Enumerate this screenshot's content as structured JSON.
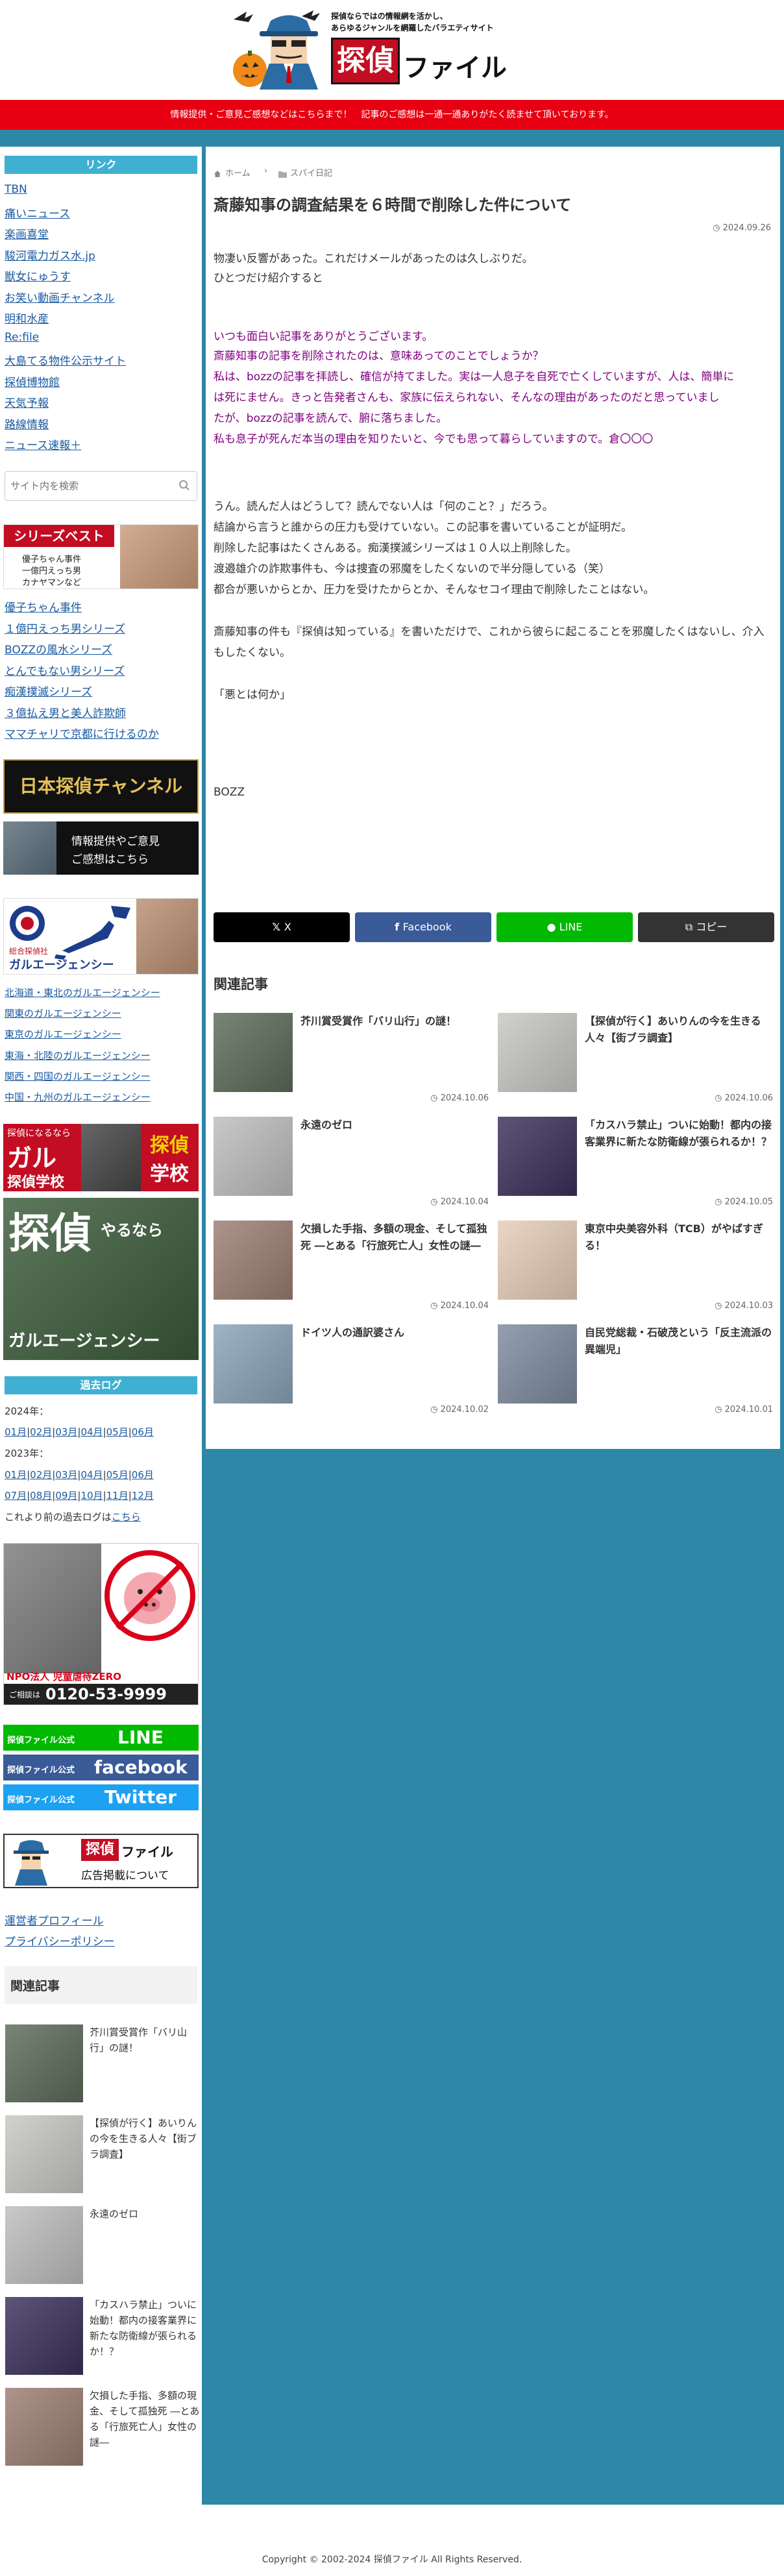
{
  "header": {
    "tagline_1": "探偵ならではの情報網を活かし、",
    "tagline_2": "あらゆるジャンルを網羅したバラエティサイト",
    "logo_text_1": "探偵",
    "logo_text_2": "ファイル"
  },
  "notice": "情報提供・ご意見ご感想などはこちらまで！　記事のご感想は一通一通ありがたく読ませて頂いております。",
  "sidebar": {
    "links_heading": "リンク",
    "links": [
      "TBN",
      "痛いニュース",
      "楽画喜堂",
      "駿河電力ガス水.jp",
      "獣女にゅうす",
      "お笑い動画チャンネル",
      "明和水産",
      "Re:file",
      "大島てる物件公示サイト",
      "探偵博物館",
      "天気予報",
      "路線情報",
      "ニュース速報＋"
    ],
    "search_placeholder": "サイト内を検索",
    "series_banner": {
      "title": "シリーズベスト",
      "line1": "優子ちゃん事件",
      "line2": "一億円えっち男",
      "line3": "カナヤマンなど"
    },
    "series": [
      "優子ちゃん事件",
      "１億円えっち男シリーズ",
      "BOZZの風水シリーズ",
      "とんでもない男シリーズ",
      "痴漢撲滅シリーズ",
      "３億払え男と美人詐欺師",
      "ママチャリで京都に行けるのか"
    ],
    "nihon_banner": "日本探偵チャンネル",
    "info_banner": {
      "line1": "情報提供やご意見",
      "line2": "ご感想はこちら"
    },
    "agency_banner": {
      "label": "総合探偵社",
      "name": "ガルエージェンシー"
    },
    "regions": [
      "北海道・東北のガルエージェンシー",
      "関東のガルエージェンシー",
      "東京のガルエージェンシー",
      "東海・北陸のガルエージェンシー",
      "関西・四国のガルエージェンシー",
      "中国・九州のガルエージェンシー"
    ],
    "school_banner": {
      "line1": "探偵になるなら",
      "line2": "ガル",
      "line3": "探偵学校",
      "side1": "探偵",
      "side2": "学校"
    },
    "tantei_banner": {
      "line1": "探偵",
      "line2": "やるなら",
      "line3": "ガルエージェンシー"
    },
    "archive_heading": "過去ログ",
    "archive_2024_label": "2024年：",
    "archive_2024": [
      "01月",
      "02月",
      "03月",
      "04月",
      "05月",
      "06月"
    ],
    "archive_2023_label": "2023年：",
    "archive_2023_a": [
      "01月",
      "02月",
      "03月",
      "04月",
      "05月",
      "06月"
    ],
    "archive_2023_b": [
      "07月",
      "08月",
      "09月",
      "10月",
      "11月",
      "12月"
    ],
    "archive_more_text": "これより前の過去ログは",
    "archive_more_link": "こちら",
    "npo_banner": {
      "name": "NPO法人 児童虐待ZERO",
      "contact": "ご相談は",
      "phone": "0120-53-9999"
    },
    "sns_prefix": "探偵ファイル公式",
    "sns": [
      "LINE",
      "facebook",
      "Twitter"
    ],
    "ad_banner": {
      "logo1": "探偵",
      "logo2": "ファイル",
      "text": "広告掲載について"
    },
    "bottom_links": [
      "運営者プロフィール",
      "プライバシーポリシー"
    ],
    "related_heading": "関連記事",
    "related": [
      "芥川賞受賞作「バリ山行」の謎！",
      "【探偵が行く】あいりんの今を生きる人々【街ブラ調査】",
      "永遠のゼロ",
      "「カスハラ禁止」ついに始動！都内の接客業界に新たな防衛線が張られるか！？",
      "欠損した手指、多額の現金、そして孤独死 ―とある「行旅死亡人」女性の謎―"
    ]
  },
  "main": {
    "breadcrumb": [
      "ホーム",
      "スパイ日記"
    ],
    "title": "斎藤知事の調査結果を６時間で削除した件について",
    "date": "2024.09.26",
    "intro": [
      "物凄い反響があった。これだけメールがあったのは久しぶりだ。",
      "ひとつだけ紹介すると"
    ],
    "quote": [
      "いつも面白い記事をありがとうございます。",
      "斎藤知事の記事を削除されたのは、意味あってのことでしょうか？",
      "私は、bozzの記事を拝読し、確信が持てました。実は一人息子を自死で亡くしていますが、人は、簡単に",
      "は死にません。きっと告発者さんも、家族に伝えられない、そんなの理由があったのだと思っていまし",
      "たが、bozzの記事を読んで、腑に落ちました。",
      "私も息子が死んだ本当の理由を知りたいと、今でも思って暮らしていますので。倉〇〇〇"
    ],
    "body1": [
      "うん。読んだ人はどうして？読んでない人は「何のこと？」だろう。",
      "結論から言うと誰からの圧力も受けていない。この記事を書いていることが証明だ。",
      "削除した記事はたくさんある。痴漢撲滅シリーズは１０人以上削除した。",
      "渡邉雄介の詐欺事件も、今は捜査の邪魔をしたくないので半分隠している（笑）",
      "都合が悪いからとか、圧力を受けたからとか、そんなセコイ理由で削除したことはない。"
    ],
    "body2": [
      "斎藤知事の件も『探偵は知っている』を書いただけで、これから彼らに起こることを邪魔したくはないし、介入もしたくない。"
    ],
    "body3": "「悪とは何か」",
    "signature": "BOZZ",
    "share": {
      "x": "X",
      "facebook": "Facebook",
      "line": "LINE",
      "copy": "コピー"
    },
    "share_colors": {
      "x": "#000000",
      "facebook": "#3a5a98",
      "line": "#00b900",
      "copy": "#333333"
    },
    "related_heading": "関連記事",
    "related": [
      {
        "title": "芥川賞受賞作「バリ山行」の謎！",
        "date": "2024.10.06"
      },
      {
        "title": "【探偵が行く】あいりんの今を生きる人々【街ブラ調査】",
        "date": "2024.10.06"
      },
      {
        "title": "永遠のゼロ",
        "date": "2024.10.04"
      },
      {
        "title": "「カスハラ禁止」ついに始動！都内の接客業界に新たな防衛線が張られるか！？",
        "date": "2024.10.05"
      },
      {
        "title": "欠損した手指、多額の現金、そして孤独死 ―とある「行旅死亡人」女性の謎―",
        "date": "2024.10.04"
      },
      {
        "title": "東京中央美容外科（TCB）がやばすぎる！",
        "date": "2024.10.03"
      },
      {
        "title": "ドイツ人の通訳婆さん",
        "date": "2024.10.02"
      },
      {
        "title": "自民党総裁・石破茂という「反主流派の異端児」",
        "date": "2024.10.01"
      }
    ]
  },
  "footer": {
    "copyright": "Copyright © 2002-2024 探偵ファイル All Rights Reserved."
  },
  "colors": {
    "background": "#2e87a6",
    "notice": "#e60012",
    "side_heading": "#3fb0d2",
    "link": "#1a5aa0",
    "quote": "#800080"
  }
}
